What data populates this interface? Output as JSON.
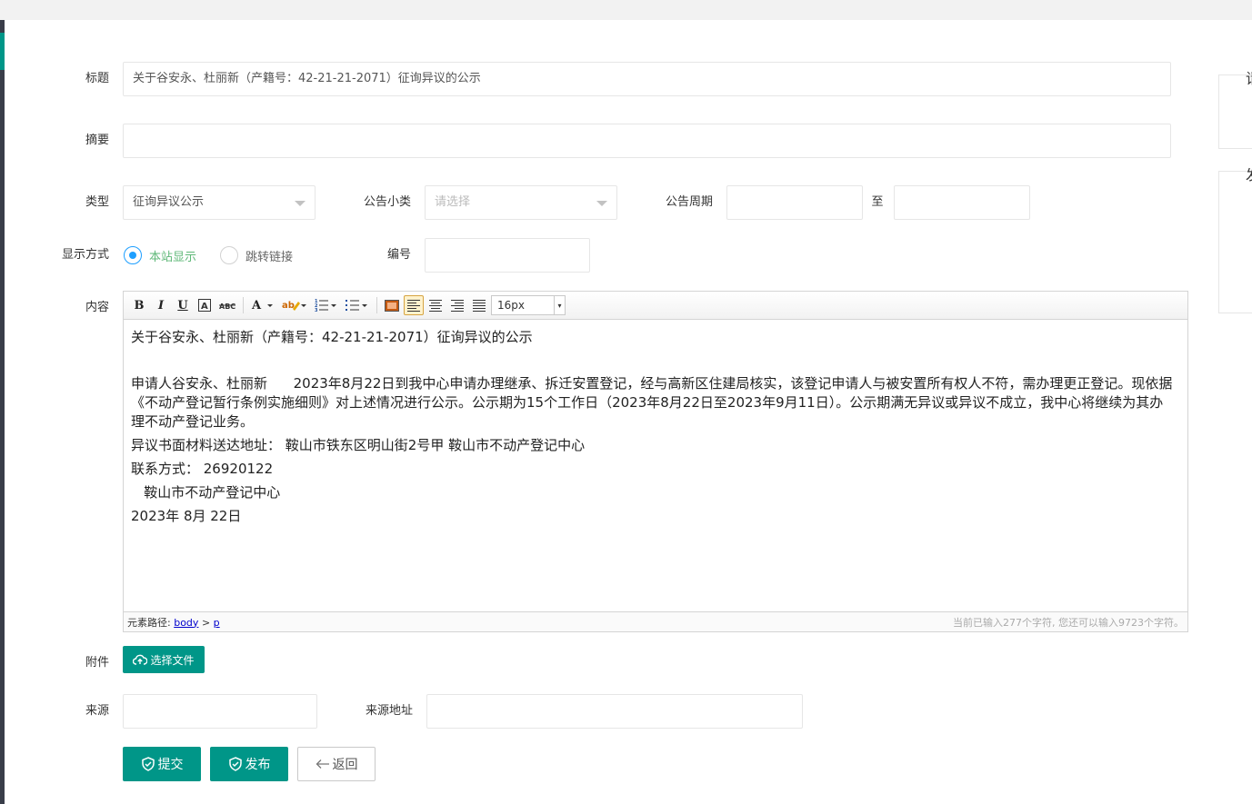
{
  "form": {
    "title_label": "标题",
    "title_value": "关于谷安永、杜丽新（产籍号：42-21-21-2071）征询异议的公示",
    "summary_label": "摘要",
    "summary_value": "",
    "type_label": "类型",
    "type_value": "征询异议公示",
    "subtype_label": "公告小类",
    "subtype_placeholder": "请选择",
    "period_label": "公告周期",
    "period_to": "至",
    "display_label": "显示方式",
    "display_options": [
      "本站显示",
      "跳转链接"
    ],
    "display_selected": "本站显示",
    "number_label": "编号",
    "content_label": "内容",
    "attachment_label": "附件",
    "upload_button": "选择文件",
    "source_label": "来源",
    "source_url_label": "来源地址",
    "submit_button": "提交",
    "publish_button": "发布",
    "back_button": "返回"
  },
  "editor": {
    "toolbar": {
      "bold": "B",
      "italic": "I",
      "underline": "U",
      "font_size_value": "16px"
    },
    "content_lines": [
      "关于谷安永、杜丽新（产籍号：42-21-21-2071）征询异议的公示",
      "",
      "申请人谷安永、杜丽新      2023年8月22日到我中心申请办理继承、拆迁安置登记，经与高新区住建局核实，该登记申请人与被安置所有权人不符，需办理更正登记。现依据《不动产登记暂行条例实施细则》对上述情况进行公示。公示期为15个工作日（2023年8月22日至2023年9月11日）。公示期满无异议或异议不成立，我中心将继续为其办理不动产登记业务。",
      "异议书面材料送达地址： 鞍山市铁东区明山街2号甲 鞍山市不动产登记中心",
      "联系方式： 26920122",
      "   鞍山市不动产登记中心",
      "2023年 8月 22日"
    ],
    "status": {
      "path_label": "元素路径:",
      "path_body": "body",
      "path_sep": ">",
      "path_p": "p",
      "char_count": "当前已输入277个字符, 您还可以输入9723个字符。"
    }
  },
  "right_panel": {
    "char1": "请",
    "char2": "发"
  },
  "colors": {
    "primary": "#009688",
    "radio_active": "#1e9fff",
    "radio_text_active": "#5FB878"
  }
}
